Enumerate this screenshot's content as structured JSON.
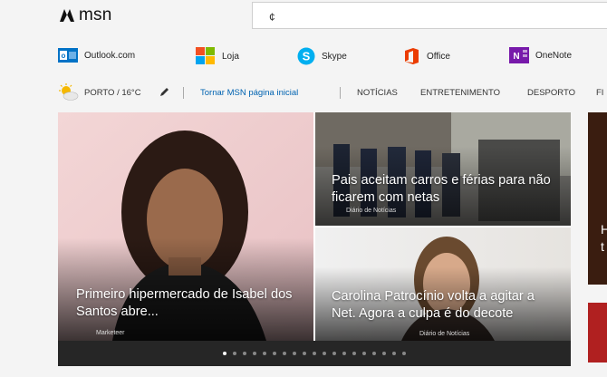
{
  "header": {
    "logo_text": "msn",
    "search_value": "¢"
  },
  "apps": [
    {
      "label": "Outlook.com",
      "icon": "outlook-icon",
      "color": "#0072c6"
    },
    {
      "label": "Loja",
      "icon": "store-icon",
      "color": "#f25022"
    },
    {
      "label": "Skype",
      "icon": "skype-icon",
      "color": "#00aff0"
    },
    {
      "label": "Office",
      "icon": "office-icon",
      "color": "#eb3c00"
    },
    {
      "label": "OneNote",
      "icon": "onenote-icon",
      "color": "#7719aa"
    }
  ],
  "nav": {
    "weather": "PORTO / 16°C",
    "homepage_link": "Tornar MSN página inicial",
    "items": [
      "NOTÍCIAS",
      "ENTRETENIMENTO",
      "DESPORTO",
      "FI"
    ],
    "link_color": "#0063b1"
  },
  "cards": [
    {
      "title": "Primeiro hipermercado de Isabel dos Santos abre...",
      "source": "Marketeer"
    },
    {
      "title": "Pais aceitam carros e férias para não ficarem com netas",
      "source": "Diário de Notícias"
    },
    {
      "title": "Carolina Patrocínio volta a agitar a Net. Agora a culpa é do decote",
      "source": "Diário de Notícias"
    },
    {
      "title": "H\nt",
      "source": ""
    }
  ],
  "carousel": {
    "dot_count": 19,
    "active_index": 0
  }
}
